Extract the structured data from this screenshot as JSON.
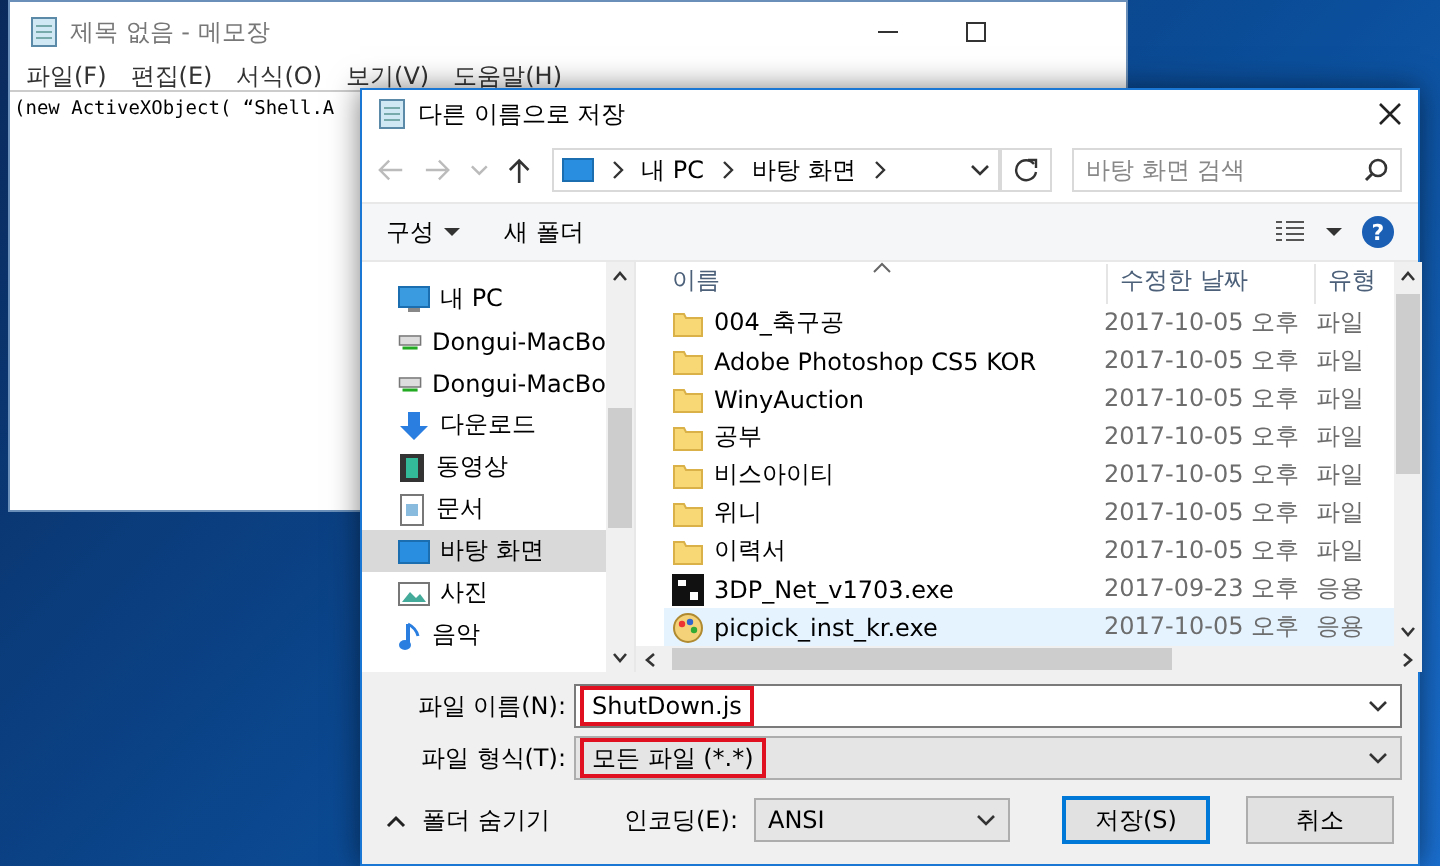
{
  "notepad": {
    "title": "제목 없음 - 메모장",
    "menu": [
      "파일(F)",
      "편집(E)",
      "서식(O)",
      "보기(V)",
      "도움말(H)"
    ],
    "text": "(new ActiveXObject( “Shell.A"
  },
  "dialog": {
    "title": "다른 이름으로 저장",
    "address": [
      "내 PC",
      "바탕 화면"
    ],
    "search": {
      "placeholder": "바탕 화면 검색"
    },
    "toolbar": {
      "organize": "구성",
      "new_folder": "새 폴더",
      "help": "?"
    },
    "nav": [
      {
        "kind": "pc",
        "label": "내 PC",
        "selected": false
      },
      {
        "kind": "drive",
        "label": "Dongui-MacBo",
        "selected": false
      },
      {
        "kind": "drive",
        "label": "Dongui-MacBo",
        "selected": false
      },
      {
        "kind": "download",
        "label": "다운로드",
        "selected": false
      },
      {
        "kind": "video",
        "label": "동영상",
        "selected": false
      },
      {
        "kind": "docs",
        "label": "문서",
        "selected": false
      },
      {
        "kind": "desktop",
        "label": "바탕 화면",
        "selected": true
      },
      {
        "kind": "photos",
        "label": "사진",
        "selected": false
      },
      {
        "kind": "music",
        "label": "음악",
        "selected": false
      }
    ],
    "columns": [
      "이름",
      "수정한 날짜",
      "유형"
    ],
    "files": [
      {
        "kind": "folder",
        "name": "004_축구공",
        "date": "2017-10-05 오후",
        "type": "파일",
        "selected": false
      },
      {
        "kind": "folder",
        "name": "Adobe Photoshop CS5 KOR",
        "date": "2017-10-05 오후",
        "type": "파일",
        "selected": false
      },
      {
        "kind": "folder",
        "name": "WinyAuction",
        "date": "2017-10-05 오후",
        "type": "파일",
        "selected": false
      },
      {
        "kind": "folder",
        "name": "공부",
        "date": "2017-10-05 오후",
        "type": "파일",
        "selected": false
      },
      {
        "kind": "folder",
        "name": "비스아이티",
        "date": "2017-10-05 오후",
        "type": "파일",
        "selected": false
      },
      {
        "kind": "folder",
        "name": "위니",
        "date": "2017-10-05 오후",
        "type": "파일",
        "selected": false
      },
      {
        "kind": "folder",
        "name": "이력서",
        "date": "2017-10-05 오후",
        "type": "파일",
        "selected": false
      },
      {
        "kind": "dp-app",
        "name": "3DP_Net_v1703.exe",
        "date": "2017-09-23 오후",
        "type": "응용",
        "selected": false
      },
      {
        "kind": "paint-app",
        "name": "picpick_inst_kr.exe",
        "date": "2017-10-05 오후",
        "type": "응용",
        "selected": true
      }
    ],
    "filename": {
      "label": "파일 이름(N):",
      "value": "ShutDown.js"
    },
    "filetype": {
      "label": "파일 형식(T):",
      "value": "모든 파일 (*.*)"
    },
    "hide_folders": "폴더 숨기기",
    "encoding": {
      "label": "인코딩(E):",
      "value": "ANSI"
    },
    "buttons": [
      {
        "label": "저장(S)",
        "default": true
      },
      {
        "label": "취소",
        "default": false
      }
    ]
  }
}
